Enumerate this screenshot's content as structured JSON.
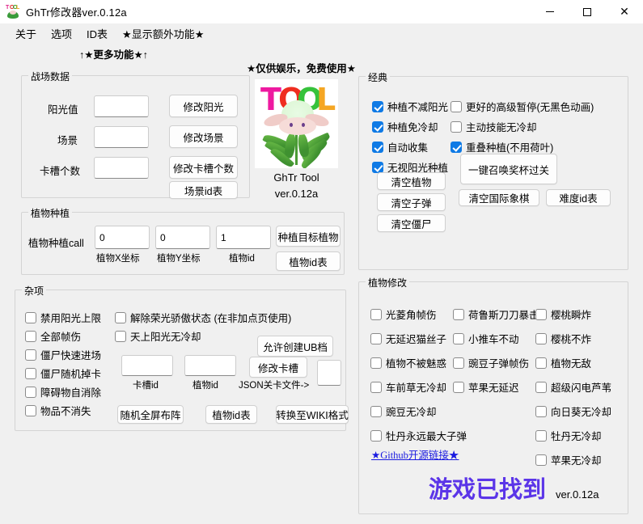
{
  "window": {
    "title": "GhTr修改器ver.0.12a",
    "icon": "tool-plant-icon",
    "controls": {
      "minimize": "−",
      "maximize": "□",
      "close": "✕"
    }
  },
  "menu": {
    "items": [
      {
        "label": "关于",
        "name": "menu-about"
      },
      {
        "label": "选项",
        "name": "menu-options"
      },
      {
        "label": "ID表",
        "name": "menu-id-table"
      },
      {
        "label": "★显示额外功能★",
        "name": "menu-extra-features"
      }
    ]
  },
  "banners": {
    "more_functions": "↑★更多功能★↑",
    "entertainment_only": "★仅供娱乐，免费使用★"
  },
  "battlefield": {
    "title": "战场数据",
    "rows": [
      {
        "label": "阳光值",
        "value": "",
        "button": "修改阳光"
      },
      {
        "label": "场景",
        "value": "",
        "button": "修改场景"
      },
      {
        "label": "卡槽个数",
        "value": "",
        "button": "修改卡槽个数"
      }
    ],
    "scene_id_table_button": "场景id表"
  },
  "logo": {
    "letters": [
      "T",
      "O",
      "O",
      "L"
    ],
    "caption_line1": "GhTr Tool",
    "caption_line2": "ver.0.12a"
  },
  "planting": {
    "title": "植物种植",
    "call_label": "植物种植call",
    "fields": [
      {
        "value": "0",
        "caption": "植物X坐标"
      },
      {
        "value": "0",
        "caption": "植物Y坐标"
      },
      {
        "value": "1",
        "caption": "植物id"
      }
    ],
    "plant_target_button": "种植目标植物",
    "plant_id_table_button": "植物id表"
  },
  "misc": {
    "title": "杂项",
    "left_checks": [
      {
        "label": "禁用阳光上限",
        "checked": false
      },
      {
        "label": "全部帧伤",
        "checked": false
      },
      {
        "label": "僵尸快速进场",
        "checked": false
      },
      {
        "label": "僵尸随机掉卡",
        "checked": false
      },
      {
        "label": "障碍物自消除",
        "checked": false
      },
      {
        "label": "物品不消失",
        "checked": false
      }
    ],
    "right_checks": [
      {
        "label": "解除荣光骄傲状态 (在非加点页使用)",
        "checked": false
      },
      {
        "label": "天上阳光无冷却",
        "checked": false
      }
    ],
    "allow_ub_button": "允许创建UB档",
    "slot_id_value": "",
    "slot_id_caption": "卡槽id",
    "plant_id_value": "",
    "plant_id_caption": "植物id",
    "json_level_caption": "JSON关卡文件->",
    "json_path_value": "",
    "modify_slot_button": "修改卡槽",
    "buttons": [
      "随机全屏布阵",
      "植物id表",
      "转换至WIKI格式"
    ]
  },
  "classic": {
    "title": "经典",
    "left_checks": [
      {
        "label": "种植不减阳光",
        "checked": true
      },
      {
        "label": "种植免冷却",
        "checked": true
      },
      {
        "label": "自动收集",
        "checked": true
      },
      {
        "label": "无视阳光种植",
        "checked": true
      }
    ],
    "right_checks": [
      {
        "label": "更好的高级暂停(无黑色动画)",
        "checked": false
      },
      {
        "label": "主动技能无冷却",
        "checked": false
      },
      {
        "label": "重叠种植(不用荷叶)",
        "checked": true
      }
    ],
    "clear_buttons": [
      "清空植物",
      "清空子弹",
      "清空僵尸"
    ],
    "trophy_button": "一键召唤奖杯过关",
    "chess_button": "清空国际象棋",
    "difficulty_button": "难度id表"
  },
  "plant_modify": {
    "title": "植物修改",
    "col1": [
      {
        "label": "光菱角帧伤",
        "checked": false
      },
      {
        "label": "无延迟猫丝子",
        "checked": false
      },
      {
        "label": "植物不被魅惑",
        "checked": false
      },
      {
        "label": "车前草无冷却",
        "checked": false
      },
      {
        "label": "豌豆无冷却",
        "checked": false
      },
      {
        "label": "牡丹永远最大子弹",
        "checked": false
      }
    ],
    "col2": [
      {
        "label": "荷鲁斯刀刀暴击",
        "checked": false
      },
      {
        "label": "小推车不动",
        "checked": false
      },
      {
        "label": "豌豆子弹帧伤",
        "checked": false
      },
      {
        "label": "苹果无延迟",
        "checked": false
      }
    ],
    "col3": [
      {
        "label": "樱桃瞬炸",
        "checked": false
      },
      {
        "label": "樱桃不炸",
        "checked": false
      },
      {
        "label": "植物无敌",
        "checked": false
      },
      {
        "label": "超级闪电芦苇",
        "checked": false
      },
      {
        "label": "向日葵无冷却",
        "checked": false
      },
      {
        "label": "牡丹无冷却",
        "checked": false
      },
      {
        "label": "苹果无冷却",
        "checked": false
      }
    ],
    "github_link": "★Github开源链接★",
    "status": "游戏已找到",
    "version": "ver.0.12a"
  },
  "colors": {
    "accent_checked": "#0f7ae5",
    "status_text": "#5b35e8",
    "link": "#1a1ae0"
  }
}
